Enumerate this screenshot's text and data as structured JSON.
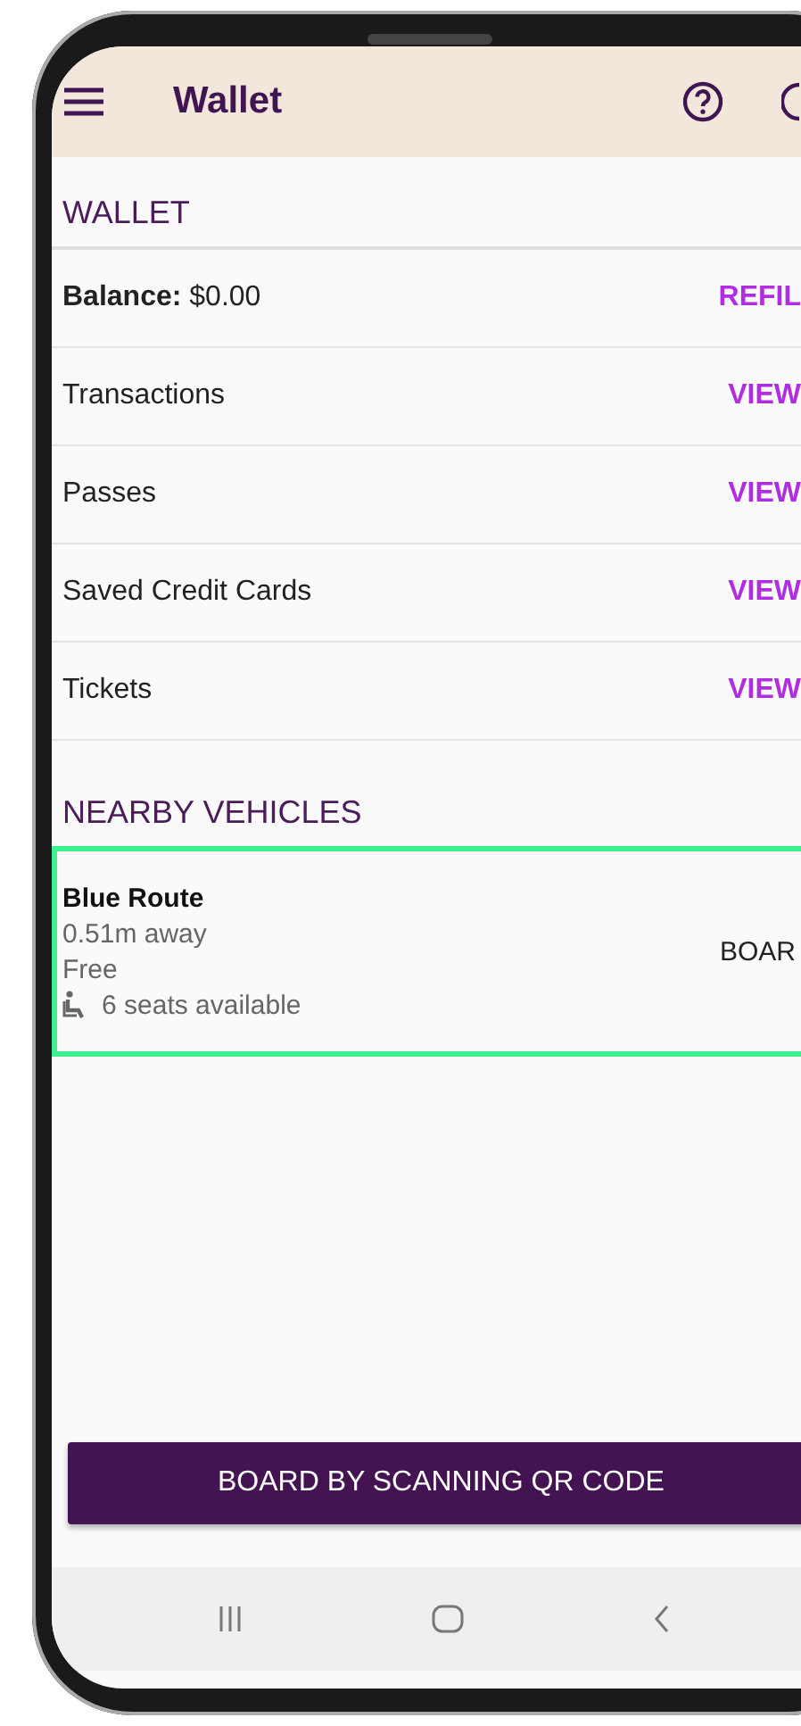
{
  "app_bar": {
    "title": "Wallet"
  },
  "wallet": {
    "heading": "WALLET",
    "rows": [
      {
        "kind": "balance",
        "label": "Balance:",
        "value": "$0.00",
        "action": "REFIL"
      },
      {
        "kind": "link",
        "label": "Transactions",
        "action": "VIEW"
      },
      {
        "kind": "link",
        "label": "Passes",
        "action": "VIEW"
      },
      {
        "kind": "link",
        "label": "Saved Credit Cards",
        "action": "VIEW"
      },
      {
        "kind": "link",
        "label": "Tickets",
        "action": "VIEW"
      }
    ]
  },
  "nearby": {
    "heading": "NEARBY VEHICLES",
    "vehicles": [
      {
        "route": "Blue Route",
        "distance": "0.51m away",
        "fare": "Free",
        "seats": "6 seats available",
        "action": "BOAR",
        "selected": true
      }
    ]
  },
  "scan_button": "BOARD BY SCANNING QR CODE"
}
